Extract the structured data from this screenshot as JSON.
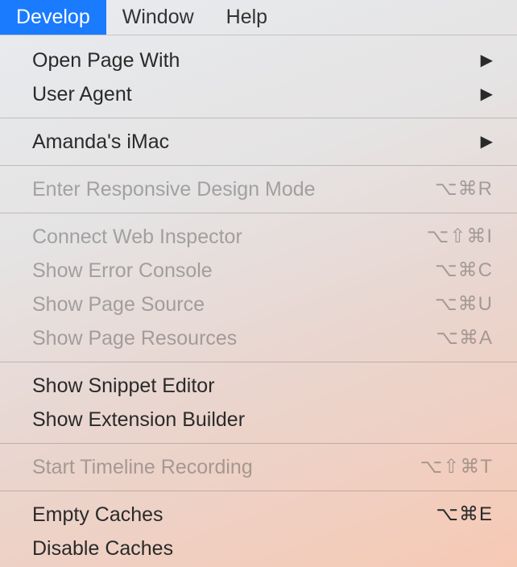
{
  "menubar": {
    "items": [
      {
        "label": "Develop",
        "active": true
      },
      {
        "label": "Window",
        "active": false
      },
      {
        "label": "Help",
        "active": false
      }
    ]
  },
  "menu": {
    "groups": [
      [
        {
          "label": "Open Page With",
          "submenu": true,
          "disabled": false
        },
        {
          "label": "User Agent",
          "submenu": true,
          "disabled": false
        }
      ],
      [
        {
          "label": "Amanda's iMac",
          "submenu": true,
          "disabled": false
        }
      ],
      [
        {
          "label": "Enter Responsive Design Mode",
          "shortcut": "⌥⌘R",
          "disabled": true
        }
      ],
      [
        {
          "label": "Connect Web Inspector",
          "shortcut": "⌥⇧⌘I",
          "disabled": true
        },
        {
          "label": "Show Error Console",
          "shortcut": "⌥⌘C",
          "disabled": true
        },
        {
          "label": "Show Page Source",
          "shortcut": "⌥⌘U",
          "disabled": true
        },
        {
          "label": "Show Page Resources",
          "shortcut": "⌥⌘A",
          "disabled": true
        }
      ],
      [
        {
          "label": "Show Snippet Editor",
          "disabled": false
        },
        {
          "label": "Show Extension Builder",
          "disabled": false
        }
      ],
      [
        {
          "label": "Start Timeline Recording",
          "shortcut": "⌥⇧⌘T",
          "disabled": true
        }
      ],
      [
        {
          "label": "Empty Caches",
          "shortcut": "⌥⌘E",
          "disabled": false
        },
        {
          "label": "Disable Caches",
          "disabled": false
        }
      ]
    ]
  }
}
